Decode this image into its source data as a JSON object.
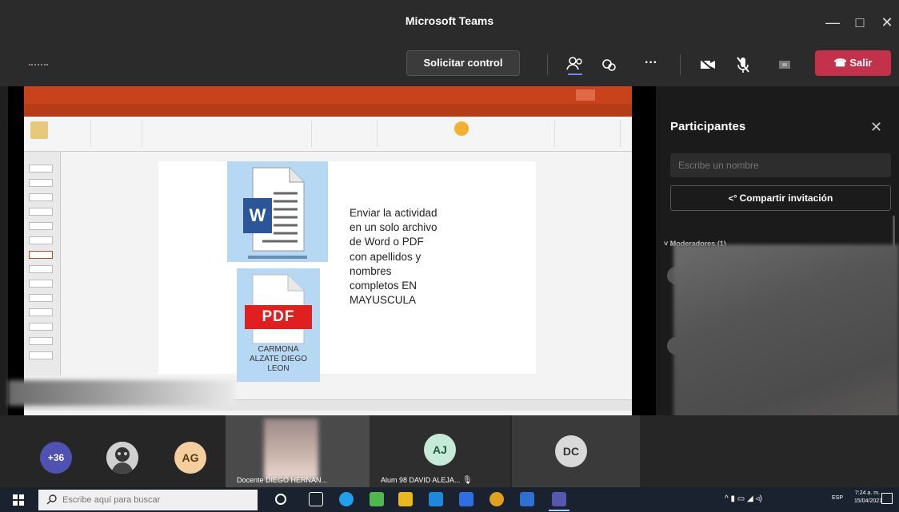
{
  "window": {
    "title": "Microsoft Teams",
    "controls": [
      "—",
      "□",
      "✕"
    ]
  },
  "toolbar": {
    "request_control_label": "Solicitar control",
    "more_label": "···",
    "leave_label": "Salir"
  },
  "shared_screen": {
    "slide": {
      "word_icon_letter": "W",
      "pdf_label": "PDF",
      "pdf_caption": [
        "CARMONA",
        "ALZATE DIEGO",
        "LEON"
      ],
      "instruction_lines": [
        "Enviar la actividad",
        "en un solo archivo",
        "de Word o PDF",
        "con apellidos y",
        "nombres",
        "completos EN",
        "MAYUSCULA"
      ]
    }
  },
  "participants_panel": {
    "title": "Participantes",
    "search_placeholder": "Escribe un nombre",
    "invite_label": "Compartir invitación",
    "moderators_label": "Moderadores (1)"
  },
  "video_strip": {
    "overflow_count": "+36",
    "tiles": [
      {
        "initials": "AG",
        "color": "#f4ce9d",
        "text_color": "#5a3b13"
      },
      {
        "initials": "AJ",
        "color": "#c5ead8",
        "text_color": "#1d5c40"
      },
      {
        "initials": "DC",
        "color": "#d9d9d9",
        "text_color": "#333333"
      }
    ],
    "video_tile_name": "Docente DIEGO HERNAN...",
    "aj_name": "Alum 98 DAVID ALEJA..."
  },
  "taskbar": {
    "search_placeholder": "Escribe aquí para buscar",
    "lang": "ESP",
    "time": "7:24 a. m.",
    "date": "15/04/2021"
  },
  "colors": {
    "leave_red": "#c4314b",
    "ppt_orange": "#c8431b",
    "teams_dark": "#2b2b2b"
  }
}
